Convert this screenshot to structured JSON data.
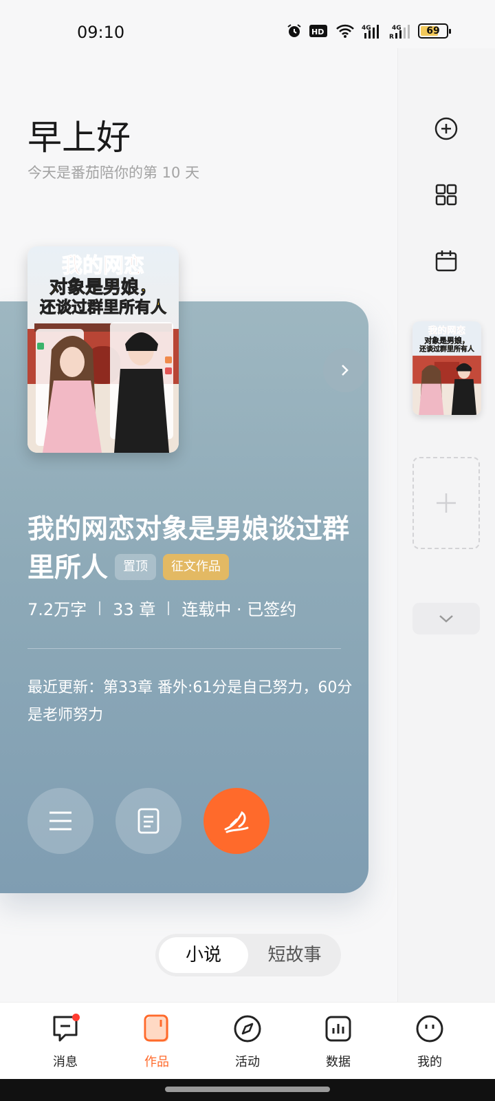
{
  "status": {
    "time": "09:10",
    "battery": "69",
    "battery_level": 0.69
  },
  "greeting": {
    "title": "早上好",
    "subtitle": "今天是番茄陪你的第 10 天"
  },
  "book": {
    "title": "我的网恋对象是男娘谈过群里所人",
    "cover_title_line1": "我的网恋",
    "cover_title_line2": "对象是男娘，",
    "cover_title_line3": "还谈过群里所有人",
    "tags": {
      "pin": "置顶",
      "contest": "征文作品"
    },
    "meta": {
      "words": "7.2万字",
      "chapters": "33 章",
      "status": "连载中 · 已签约"
    },
    "latest_update": "最近更新：第33章 番外:61分是自己努力，60分是老师努力"
  },
  "segment": {
    "novel": "小说",
    "short_story": "短故事"
  },
  "nav": [
    {
      "label": "消息",
      "icon": "message-icon"
    },
    {
      "label": "作品",
      "icon": "works-icon"
    },
    {
      "label": "活动",
      "icon": "compass-icon"
    },
    {
      "label": "数据",
      "icon": "chart-icon"
    },
    {
      "label": "我的",
      "icon": "profile-icon"
    }
  ],
  "colors": {
    "accent": "#ff6a2b",
    "card": "#8eaab8",
    "contest_tag": "#e3b963",
    "badge": "#ff3b30"
  }
}
